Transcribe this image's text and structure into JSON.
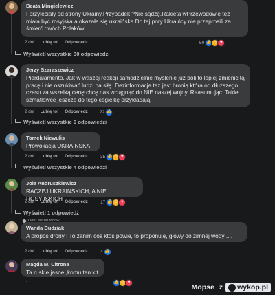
{
  "comments": [
    {
      "author": "Beata Mingielewicz",
      "text": "I przylecialy od strony Ukrainy.Przypadek ?Nie sądzę.Rakieta wPrzewodowie też miała być rosyjska a okazała się ukraińska.Do tej pory Ukraińcy nie przeprosili za śmierć dwóch Polaków.",
      "time": "2 dni",
      "like": "Lubię to!",
      "reply": "Odpowiedz",
      "reactions": "50",
      "replies": "Wyświetl wszystkie 30 odpowiedzi"
    },
    {
      "author": "Jerzy Szaraszewicz",
      "text": "Pierdalamento. Jak w waszej reakcji samodzielnie myślenie już boli to lepiej zmienić tą pracę i nie oszukiwać ludzi na siłę. Dezinformacja tez jest bronią która od dłuższego czasu za wszelką cenę chcę nas wciągnąć do NIE naszej wojny. Reasumując: Takie szmatławce jeszcze do tego cegiełkę przykładają.",
      "time": "2 dni",
      "like": "Lubię to!",
      "reply": "Odpowiedz",
      "reactions": "22",
      "replies": "Wyświetl wszystkie 9 odpowiedzi"
    },
    {
      "author": "Tomek Niewulis",
      "text": "Prowokacja UKRAINSKA",
      "time": "2 dni",
      "like": "Lubię to!",
      "reply": "Odpowiedz",
      "reactions": "35",
      "replies": "Wyświetl wszystkie 4 odpowiedzi"
    },
    {
      "author": "Jola Andruszkiewicz",
      "text": "RACZEJ UKRAINSKICH, A NIE ROSYJSKICH",
      "time": "2 dni",
      "like": "Lubię to!",
      "reply": "Odpowiedz",
      "reactions": "17",
      "replies": "Wyświetl 1 odpowiedź"
    },
    {
      "badge": "Lider wśród fanów",
      "author": "Wanda Dudziak",
      "text": "A propos drony ! To zanim coś ktoś powie, to proponuję, głowy do zimnej wody ....",
      "time": "2 dni",
      "like": "Lubię to!",
      "reply": "Odpowiedz",
      "reactions": "4"
    },
    {
      "author": "Magda M. Citrona",
      "text": "Ta ruskie jasne ,komu ten kit ."
    }
  ],
  "watermark": {
    "user": "Mopse",
    "sep": "z",
    "site": "wykop.pl"
  }
}
